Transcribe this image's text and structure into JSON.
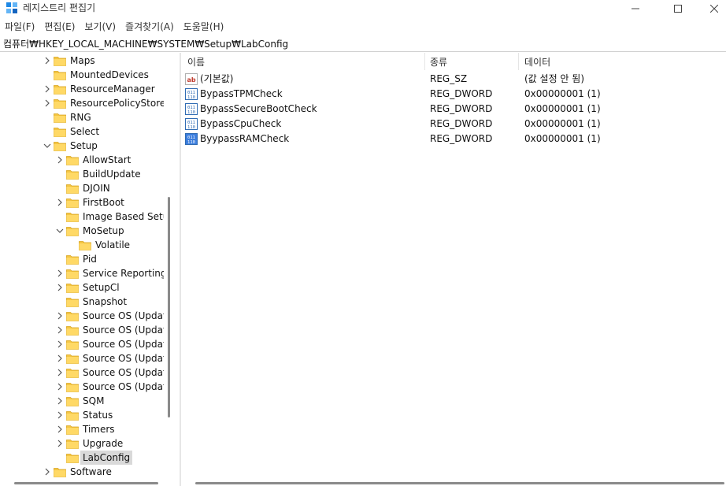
{
  "window": {
    "title": "레지스트리 편집기",
    "app_icon": "regedit-icon"
  },
  "menu": [
    "파일(F)",
    "편집(E)",
    "보기(V)",
    "즐겨찾기(A)",
    "도움말(H)"
  ],
  "address": "컴퓨터₩HKEY_LOCAL_MACHINE₩SYSTEM₩Setup₩LabConfig",
  "tree": [
    {
      "label": "Maps",
      "level": 0,
      "chevron": "right"
    },
    {
      "label": "MountedDevices",
      "level": 0,
      "chevron": "none"
    },
    {
      "label": "ResourceManager",
      "level": 0,
      "chevron": "right"
    },
    {
      "label": "ResourcePolicyStore",
      "level": 0,
      "chevron": "right"
    },
    {
      "label": "RNG",
      "level": 0,
      "chevron": "none"
    },
    {
      "label": "Select",
      "level": 0,
      "chevron": "none"
    },
    {
      "label": "Setup",
      "level": 0,
      "chevron": "down"
    },
    {
      "label": "AllowStart",
      "level": 1,
      "chevron": "right"
    },
    {
      "label": "BuildUpdate",
      "level": 1,
      "chevron": "none"
    },
    {
      "label": "DJOIN",
      "level": 1,
      "chevron": "none"
    },
    {
      "label": "FirstBoot",
      "level": 1,
      "chevron": "right"
    },
    {
      "label": "Image Based Setup",
      "level": 1,
      "chevron": "none"
    },
    {
      "label": "MoSetup",
      "level": 1,
      "chevron": "down"
    },
    {
      "label": "Volatile",
      "level": 2,
      "chevron": "none"
    },
    {
      "label": "Pid",
      "level": 1,
      "chevron": "none"
    },
    {
      "label": "Service Reporting A",
      "level": 1,
      "chevron": "right"
    },
    {
      "label": "SetupCl",
      "level": 1,
      "chevron": "right"
    },
    {
      "label": "Snapshot",
      "level": 1,
      "chevron": "none"
    },
    {
      "label": "Source OS (Update",
      "level": 1,
      "chevron": "right"
    },
    {
      "label": "Source OS (Update",
      "level": 1,
      "chevron": "right"
    },
    {
      "label": "Source OS (Update",
      "level": 1,
      "chevron": "right"
    },
    {
      "label": "Source OS (Update",
      "level": 1,
      "chevron": "right"
    },
    {
      "label": "Source OS (Update",
      "level": 1,
      "chevron": "right"
    },
    {
      "label": "Source OS (Update",
      "level": 1,
      "chevron": "right"
    },
    {
      "label": "SQM",
      "level": 1,
      "chevron": "right"
    },
    {
      "label": "Status",
      "level": 1,
      "chevron": "right"
    },
    {
      "label": "Timers",
      "level": 1,
      "chevron": "right"
    },
    {
      "label": "Upgrade",
      "level": 1,
      "chevron": "right"
    },
    {
      "label": "LabConfig",
      "level": 1,
      "chevron": "none",
      "selected": true
    },
    {
      "label": "Software",
      "level": 0,
      "chevron": "right"
    }
  ],
  "list": {
    "columns": [
      "이름",
      "종류",
      "데이터"
    ],
    "rows": [
      {
        "icon": "string-value-icon",
        "name": "(기본값)",
        "type": "REG_SZ",
        "data": "(값 설정 안 됨)"
      },
      {
        "icon": "binary-value-icon",
        "name": "BypassTPMCheck",
        "type": "REG_DWORD",
        "data": "0x00000001 (1)"
      },
      {
        "icon": "binary-value-icon",
        "name": "BypassSecureBootCheck",
        "type": "REG_DWORD",
        "data": "0x00000001 (1)"
      },
      {
        "icon": "binary-value-icon",
        "name": "BypassCpuCheck",
        "type": "REG_DWORD",
        "data": "0x00000001 (1)"
      },
      {
        "icon": "binary-value-icon",
        "name": "ByypassRAMCheck",
        "type": "REG_DWORD",
        "data": "0x00000001 (1)",
        "selected": true
      }
    ]
  },
  "colors": {
    "folder": "#f4c542",
    "selection": "#d9d9d9",
    "dword_icon": "#2f6bb3",
    "string_icon": "#c0392b"
  }
}
